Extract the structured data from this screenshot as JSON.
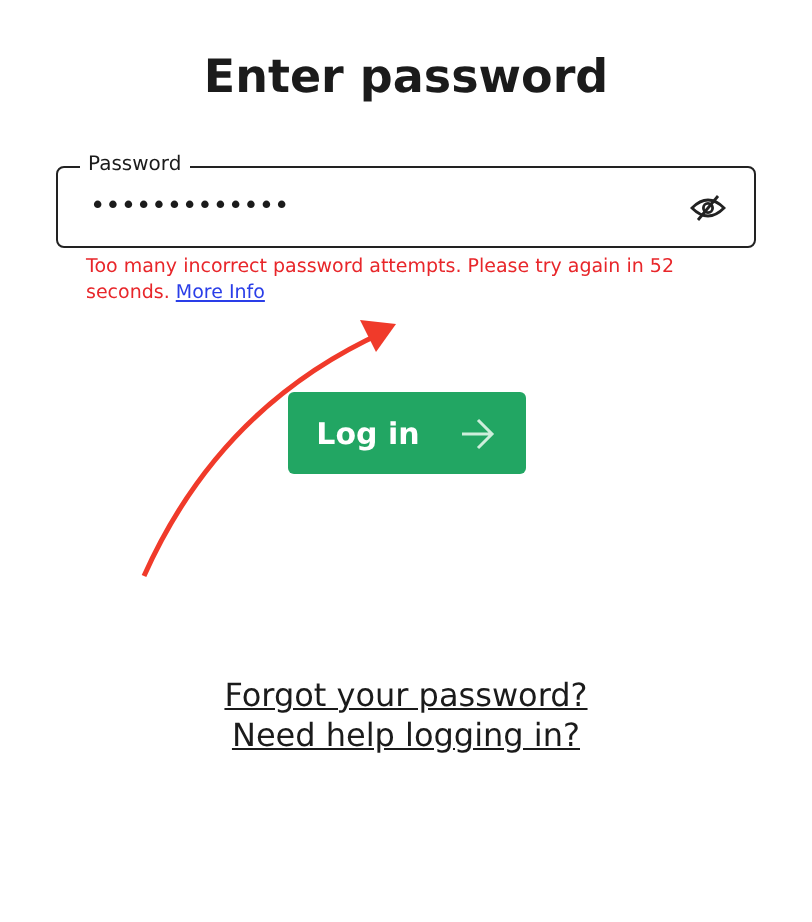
{
  "title": "Enter password",
  "password_field": {
    "label": "Password",
    "value": "•••••••••••••"
  },
  "error": {
    "message": "Too many incorrect password attempts. Please try again in 52 seconds.",
    "link": "More Info"
  },
  "login_button": {
    "label": "Log in"
  },
  "links": [
    "Forgot your password?",
    "Need help logging in?"
  ]
}
